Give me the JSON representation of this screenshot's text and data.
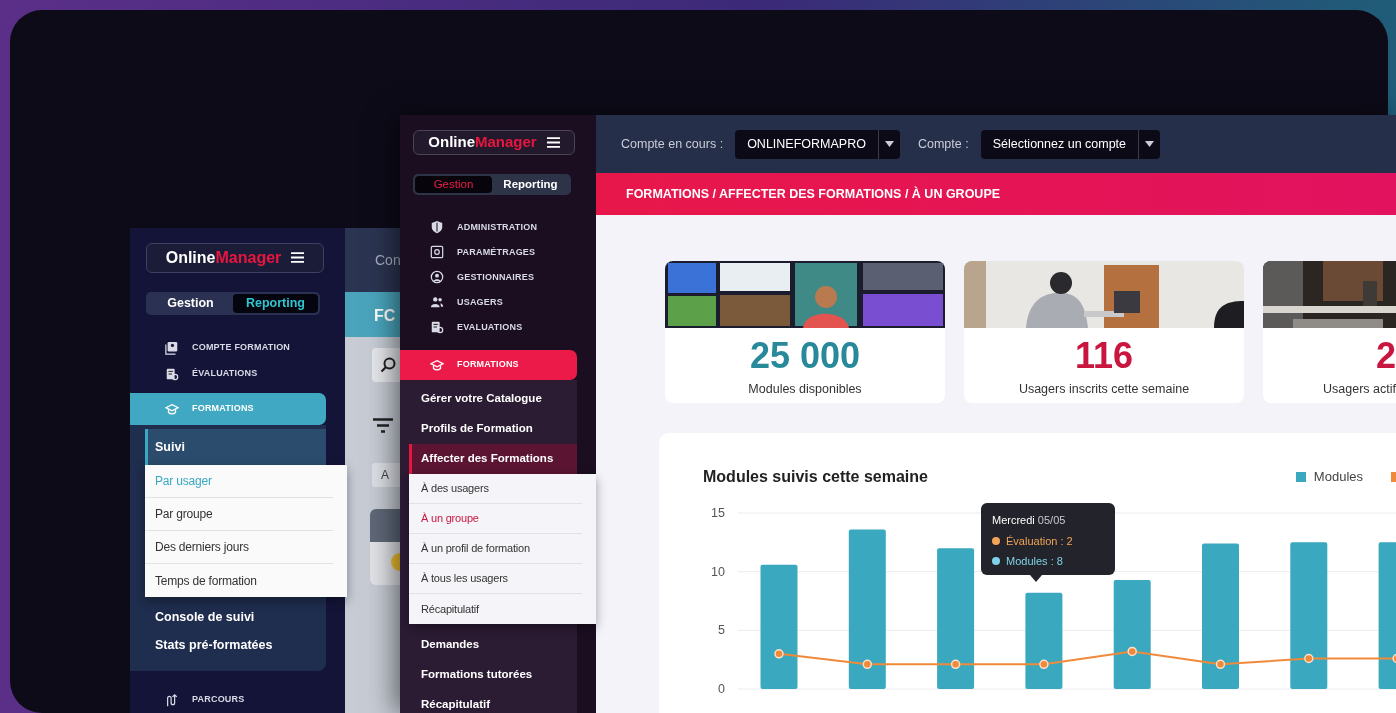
{
  "back_window": {
    "logo": {
      "primary": "Online",
      "accent": "Manager"
    },
    "modes": [
      {
        "label": "Gestion",
        "selected": false
      },
      {
        "label": "Reporting",
        "selected": true
      }
    ],
    "nav": [
      {
        "label": "COMPTE FORMATION",
        "selected": false
      },
      {
        "label": "ÉVALUATIONS",
        "selected": false
      },
      {
        "label": "FORMATIONS",
        "selected": true,
        "children": [
          {
            "label": "Suivi",
            "selected": true,
            "children": [
              {
                "label": "Par usager",
                "selected": true
              },
              {
                "label": "Par groupe",
                "selected": false
              },
              {
                "label": "Des derniers jours",
                "selected": false
              },
              {
                "label": "Temps de formation",
                "selected": false
              }
            ]
          },
          {
            "label": "Console de suivi",
            "selected": false
          },
          {
            "label": "Stats pré-formatées",
            "selected": false
          }
        ]
      },
      {
        "label": "PARCOURS",
        "selected": false
      }
    ],
    "content": {
      "topbar_text": "Con",
      "header_text": "FC",
      "button_text": "A"
    }
  },
  "front_window": {
    "logo": {
      "primary": "Online",
      "accent": "Manager"
    },
    "modes": [
      {
        "label": "Gestion",
        "selected": true
      },
      {
        "label": "Reporting",
        "selected": false
      }
    ],
    "nav": [
      {
        "label": "ADMINISTRATION",
        "selected": false
      },
      {
        "label": "PARAMÉTRAGES",
        "selected": false
      },
      {
        "label": "GESTIONNAIRES",
        "selected": false
      },
      {
        "label": "USAGERS",
        "selected": false
      },
      {
        "label": "EVALUATIONS",
        "selected": false
      },
      {
        "label": "FORMATIONS",
        "selected": true,
        "children": [
          {
            "label": "Gérer votre Catalogue",
            "selected": false
          },
          {
            "label": "Profils de Formation",
            "selected": false
          },
          {
            "label": "Affecter des Formations",
            "selected": true,
            "children": [
              {
                "label": "À des usagers",
                "selected": false
              },
              {
                "label": "À un groupe",
                "selected": true
              },
              {
                "label": "À un profil de formation",
                "selected": false
              },
              {
                "label": "À tous les usagers",
                "selected": false
              },
              {
                "label": "Récapitulatif",
                "selected": false
              }
            ]
          },
          {
            "label": "Demandes",
            "selected": false
          },
          {
            "label": "Formations tutorées",
            "selected": false
          },
          {
            "label": "Récapitulatif",
            "selected": false
          }
        ]
      }
    ],
    "topbar": {
      "account_label": "Compte en cours :",
      "account_value": "ONLINEFORMAPRO",
      "compte_label": "Compte :",
      "compte_value": "Sélectionnez un compte"
    },
    "breadcrumb": "FORMATIONS / AFFECTER DES FORMATIONS / À UN GROUPE",
    "stats": [
      {
        "kind": "picture",
        "value": "25 000",
        "label": "Modules disponibles",
        "color": "#27899a"
      },
      {
        "kind": "picture",
        "value": "116",
        "label": "Usagers inscrits cette semaine",
        "color": "#c8163f"
      },
      {
        "kind": "picture",
        "value": "2",
        "label": "Usagers actif",
        "color": "#c8163f"
      }
    ],
    "chart": {
      "title": "Modules suivis cette semaine",
      "legend": [
        {
          "show_name": true
        },
        {
          "show_name": false
        }
      ],
      "tooltip": {
        "heading": "**Mercredi** 05/05",
        "lines": [
          {
            "suffix": " : 2",
            "color": "#f0a455"
          },
          {
            "suffix": " : 8",
            "color": "#7fd3e8"
          }
        ]
      },
      "chart_data": {
        "type": "bar",
        "ylim": [
          0,
          15
        ],
        "yticks": [
          0,
          5,
          10,
          15
        ],
        "series": [
          {
            "name": "Modules",
            "color": "#3aa8bf",
            "values": [
              10.6,
              13.6,
              12,
              8.2,
              9.3,
              12.4,
              12.5,
              12.5
            ]
          },
          {
            "name": "Évaluation",
            "type": "line",
            "marker": "o",
            "color": "#f08a3a",
            "values": [
              3,
              2.1,
              2.1,
              2.1,
              3.2,
              2.1,
              2.6,
              2.6
            ]
          }
        ]
      }
    }
  }
}
